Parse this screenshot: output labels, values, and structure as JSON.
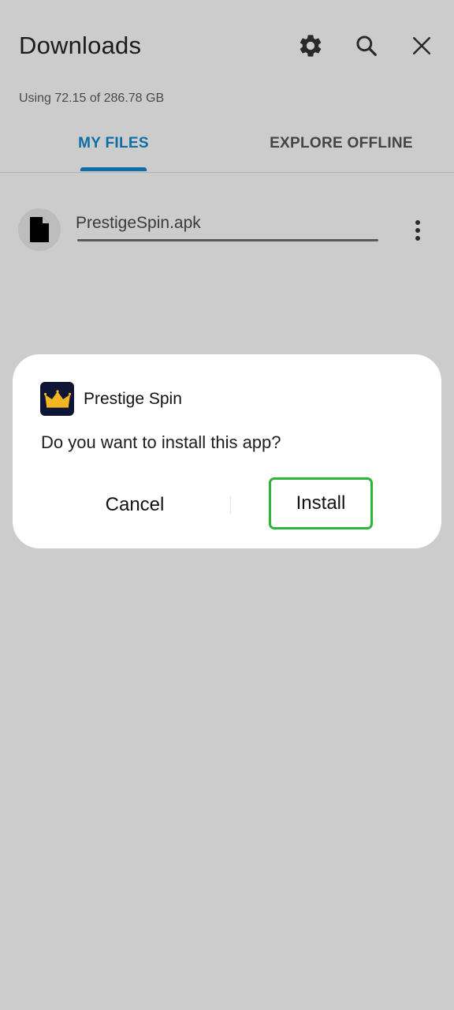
{
  "header": {
    "title": "Downloads",
    "storage": "Using 72.15 of 286.78 GB",
    "icons": [
      "gear-icon",
      "search-icon",
      "close-icon"
    ]
  },
  "tabs": [
    {
      "label": "MY FILES",
      "active": true
    },
    {
      "label": "EXPLORE OFFLINE",
      "active": false
    }
  ],
  "files": [
    {
      "name": "PrestigeSpin.apk",
      "icon": "file-icon"
    }
  ],
  "dialog": {
    "app_name": "Prestige Spin",
    "question": "Do you want to install this app?",
    "cancel_label": "Cancel",
    "install_label": "Install"
  },
  "colors": {
    "background": "#cccccc",
    "accent": "#0d6ea6",
    "install_highlight": "#2db43a",
    "app_icon_bg": "#0f1535",
    "crown": "#f2b622"
  }
}
